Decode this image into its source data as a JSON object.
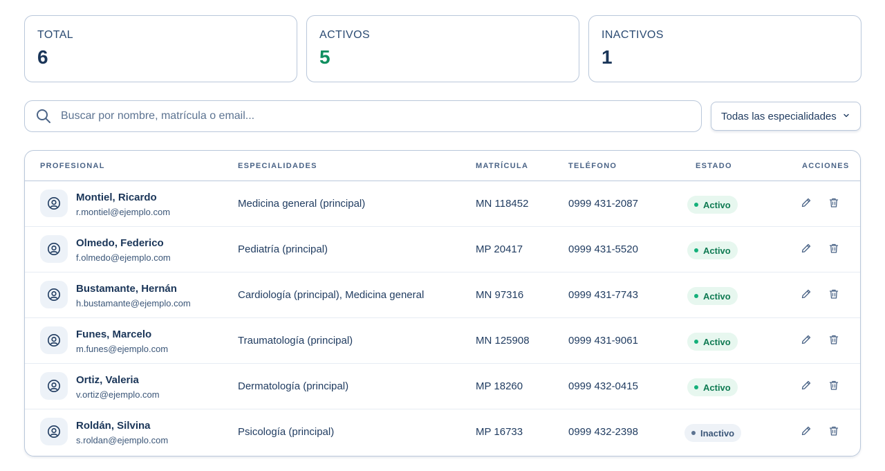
{
  "stats": {
    "total": {
      "label": "TOTAL",
      "value": "6"
    },
    "active": {
      "label": "ACTIVOS",
      "value": "5"
    },
    "inactive": {
      "label": "INACTIVOS",
      "value": "1"
    }
  },
  "search": {
    "placeholder": "Buscar por nombre, matrícula o email..."
  },
  "filter": {
    "selected": "Todas las especialidades"
  },
  "table": {
    "headers": {
      "profesional": "PROFESIONAL",
      "especialidades": "ESPECIALIDADES",
      "matricula": "MATRÍCULA",
      "telefono": "TELÉFONO",
      "estado": "ESTADO",
      "acciones": "ACCIONES"
    },
    "rows": [
      {
        "name": "Montiel, Ricardo",
        "email": "r.montiel@ejemplo.com",
        "specialties": "Medicina general (principal)",
        "license": "MN 118452",
        "phone": "0999 431-2087",
        "status": "Activo"
      },
      {
        "name": "Olmedo, Federico",
        "email": "f.olmedo@ejemplo.com",
        "specialties": "Pediatría (principal)",
        "license": "MP 20417",
        "phone": "0999 431-5520",
        "status": "Activo"
      },
      {
        "name": "Bustamante, Hernán",
        "email": "h.bustamante@ejemplo.com",
        "specialties": "Cardiología (principal), Medicina general",
        "license": "MN 97316",
        "phone": "0999 431-7743",
        "status": "Activo"
      },
      {
        "name": "Funes, Marcelo",
        "email": "m.funes@ejemplo.com",
        "specialties": "Traumatología (principal)",
        "license": "MN 125908",
        "phone": "0999 431-9061",
        "status": "Activo"
      },
      {
        "name": "Ortiz, Valeria",
        "email": "v.ortiz@ejemplo.com",
        "specialties": "Dermatología (principal)",
        "license": "MP 18260",
        "phone": "0999 432-0415",
        "status": "Activo"
      },
      {
        "name": "Roldán, Silvina",
        "email": "s.roldan@ejemplo.com",
        "specialties": "Psicología (principal)",
        "license": "MP 16733",
        "phone": "0999 432-2398",
        "status": "Inactivo"
      }
    ]
  },
  "icons": {
    "search": "search-icon",
    "chevron": "chevron-down-icon",
    "avatar": "user-circle-icon",
    "edit": "pencil-icon",
    "delete": "trash-icon"
  },
  "colors": {
    "accent_green": "#0f8f5f",
    "border": "#b9c7da",
    "text": "#1e3a5f"
  }
}
